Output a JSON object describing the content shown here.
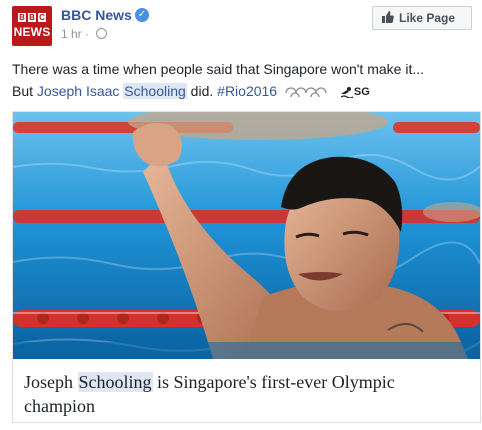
{
  "post": {
    "page_name": "BBC News",
    "avatar_letters": [
      "B",
      "B",
      "C"
    ],
    "avatar_text": "NEWS",
    "time": "1 hr",
    "like_button": "Like Page",
    "line1": "There was a time when people said that Singapore won't make it...",
    "line2_prefix": "But ",
    "mention_first": "Joseph Isaac ",
    "mention_last": "Schooling",
    "line2_mid": " did. ",
    "hashtag": "#Rio2016",
    "flag_text": "SG"
  },
  "card": {
    "title_prefix": "Joseph ",
    "title_highlight": "Schooling",
    "title_line1_rest": " is Singapore's first-ever Olympic",
    "title_line2": "champion"
  },
  "colors": {
    "link": "#365899",
    "bbc_red": "#bb1919",
    "pool_blue": "#1f8fd1"
  }
}
